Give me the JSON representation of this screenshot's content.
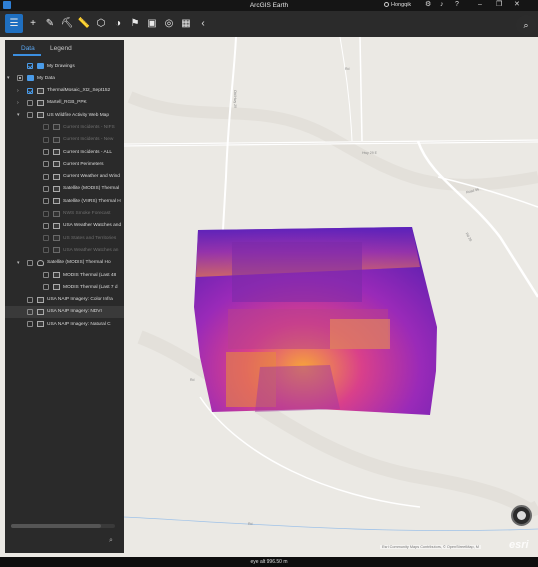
{
  "window": {
    "title": "ArcGIS Earth",
    "user": "Hongqik"
  },
  "toolbar": {
    "buttons": [
      {
        "name": "contents",
        "glyph": "☰"
      },
      {
        "name": "add-data",
        "glyph": "+"
      },
      {
        "name": "draw",
        "glyph": "✎"
      },
      {
        "name": "measure",
        "glyph": "⛏"
      },
      {
        "name": "ruler",
        "glyph": "📏"
      },
      {
        "name": "3d-model",
        "glyph": "⬡"
      },
      {
        "name": "theme",
        "glyph": "◑"
      },
      {
        "name": "bookmark",
        "glyph": "⚑"
      },
      {
        "name": "layout",
        "glyph": "▣"
      },
      {
        "name": "globe",
        "glyph": "◎"
      },
      {
        "name": "grid",
        "glyph": "▦"
      },
      {
        "name": "collapse",
        "glyph": "‹"
      }
    ]
  },
  "panel": {
    "tabs": [
      "Data",
      "Legend"
    ],
    "active_tab": "Data",
    "tree": [
      {
        "label": "My Drawings",
        "indent": 2,
        "arrow": "",
        "check": "checked",
        "icon": "folder",
        "dim": false
      },
      {
        "label": "My Data",
        "indent": 1,
        "arrow": "▾",
        "check": "partial",
        "icon": "folder",
        "dim": false
      },
      {
        "label": "ThermalMosaic_Xt2_Sept152",
        "indent": 2,
        "arrow": "›",
        "check": "checked",
        "icon": "layer",
        "dim": false
      },
      {
        "label": "Martell_RGB_PPK",
        "indent": 2,
        "arrow": "›",
        "check": "",
        "icon": "layer",
        "dim": false
      },
      {
        "label": "US Wildfire Activity Web Map",
        "indent": 2,
        "arrow": "▾",
        "check": "",
        "icon": "layer",
        "dim": false
      },
      {
        "label": "Current Incidents - NIFS",
        "indent": 3,
        "arrow": "",
        "check": "",
        "icon": "layer",
        "dim": true
      },
      {
        "label": "Current Incidents - New",
        "indent": 3,
        "arrow": "",
        "check": "",
        "icon": "layer",
        "dim": true
      },
      {
        "label": "Current Incidents - ALL",
        "indent": 3,
        "arrow": "",
        "check": "",
        "icon": "layer",
        "dim": false
      },
      {
        "label": "Current Perimeters",
        "indent": 3,
        "arrow": "",
        "check": "",
        "icon": "layer",
        "dim": false
      },
      {
        "label": "Current Weather and Wind",
        "indent": 3,
        "arrow": "",
        "check": "",
        "icon": "layer",
        "dim": false
      },
      {
        "label": "Satellite (MODIS) Thermal",
        "indent": 3,
        "arrow": "",
        "check": "",
        "icon": "layer",
        "dim": false
      },
      {
        "label": "Satellite (VIIRS) Thermal H",
        "indent": 3,
        "arrow": "",
        "check": "",
        "icon": "layer",
        "dim": false
      },
      {
        "label": "NWS Smoke Forecast",
        "indent": 3,
        "arrow": "",
        "check": "",
        "icon": "layer",
        "dim": true
      },
      {
        "label": "USA Weather Watches and",
        "indent": 3,
        "arrow": "",
        "check": "",
        "icon": "layer",
        "dim": false
      },
      {
        "label": "US States and Territories",
        "indent": 3,
        "arrow": "",
        "check": "",
        "icon": "layer",
        "dim": true
      },
      {
        "label": "USA Weather Watches an",
        "indent": 3,
        "arrow": "",
        "check": "",
        "icon": "layer",
        "dim": true
      },
      {
        "label": "Satellite (MODIS) Thermal Ho",
        "indent": 2,
        "arrow": "▾",
        "check": "",
        "icon": "stack",
        "dim": false
      },
      {
        "label": "MODIS Thermal (Last 48",
        "indent": 3,
        "arrow": "",
        "check": "",
        "icon": "layer",
        "dim": false
      },
      {
        "label": "MODIS Thermal (Last 7 d",
        "indent": 3,
        "arrow": "",
        "check": "",
        "icon": "layer",
        "dim": false
      },
      {
        "label": "USA NAIP Imagery: Color Infra",
        "indent": 2,
        "arrow": "",
        "check": "",
        "icon": "layer",
        "dim": false
      },
      {
        "label": "USA NAIP Imagery: NDVI",
        "indent": 2,
        "arrow": "",
        "check": "",
        "icon": "layer",
        "dim": false,
        "selected": true
      },
      {
        "label": "USA NAIP Imagery: Natural C",
        "indent": 2,
        "arrow": "",
        "check": "",
        "icon": "layer",
        "dim": false
      }
    ]
  },
  "map": {
    "road_labels": [
      "Old Hwy 29",
      "Hwy 29 E",
      "Rd",
      "Road 96",
      "Rd 28",
      "Rd",
      "Rd"
    ],
    "attribution": "Esri Community Maps Contributors, © OpenStreetMap, M",
    "esri_logo": "esri"
  },
  "status": {
    "eye_alt": "eye alt 996.50 m"
  }
}
